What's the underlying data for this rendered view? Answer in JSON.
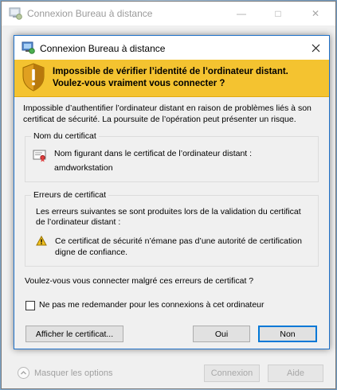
{
  "parent_window": {
    "title": "Connexion Bureau à distance",
    "options_label": "Masquer les options",
    "connect_button": "Connexion",
    "help_button": "Aide"
  },
  "dialog": {
    "title": "Connexion Bureau à distance",
    "warning_line1": "Impossible de vérifier l’identité de l’ordinateur distant.",
    "warning_line2": "Voulez-vous vraiment vous connecter ?",
    "description_line1": "Impossible d’authentifier l’ordinateur distant en raison de problèmes liés à son",
    "description_line2": "certificat de sécurité. La poursuite de l’opération peut présenter un risque.",
    "cert_name_group": {
      "title": "Nom du certificat",
      "label": "Nom figurant dans le certificat de l’ordinateur distant :",
      "value": "amdworkstation"
    },
    "cert_errors_group": {
      "title": "Erreurs de certificat",
      "intro_line1": "Les erreurs suivantes se sont produites lors de la validation du certificat",
      "intro_line2": "de l’ordinateur distant :",
      "error_line1": "Ce certificat de sécurité n’émane pas d’une autorité de certification",
      "error_line2": "digne de confiance."
    },
    "question": "Voulez-vous vous connecter malgré ces erreurs de certificat ?",
    "checkbox_label": "Ne pas me redemander pour les connexions à cet ordinateur",
    "view_cert_button": "Afficher le certificat...",
    "yes_button": "Oui",
    "no_button": "Non"
  },
  "colors": {
    "banner": "#f4c330",
    "accent": "#0078d7"
  }
}
